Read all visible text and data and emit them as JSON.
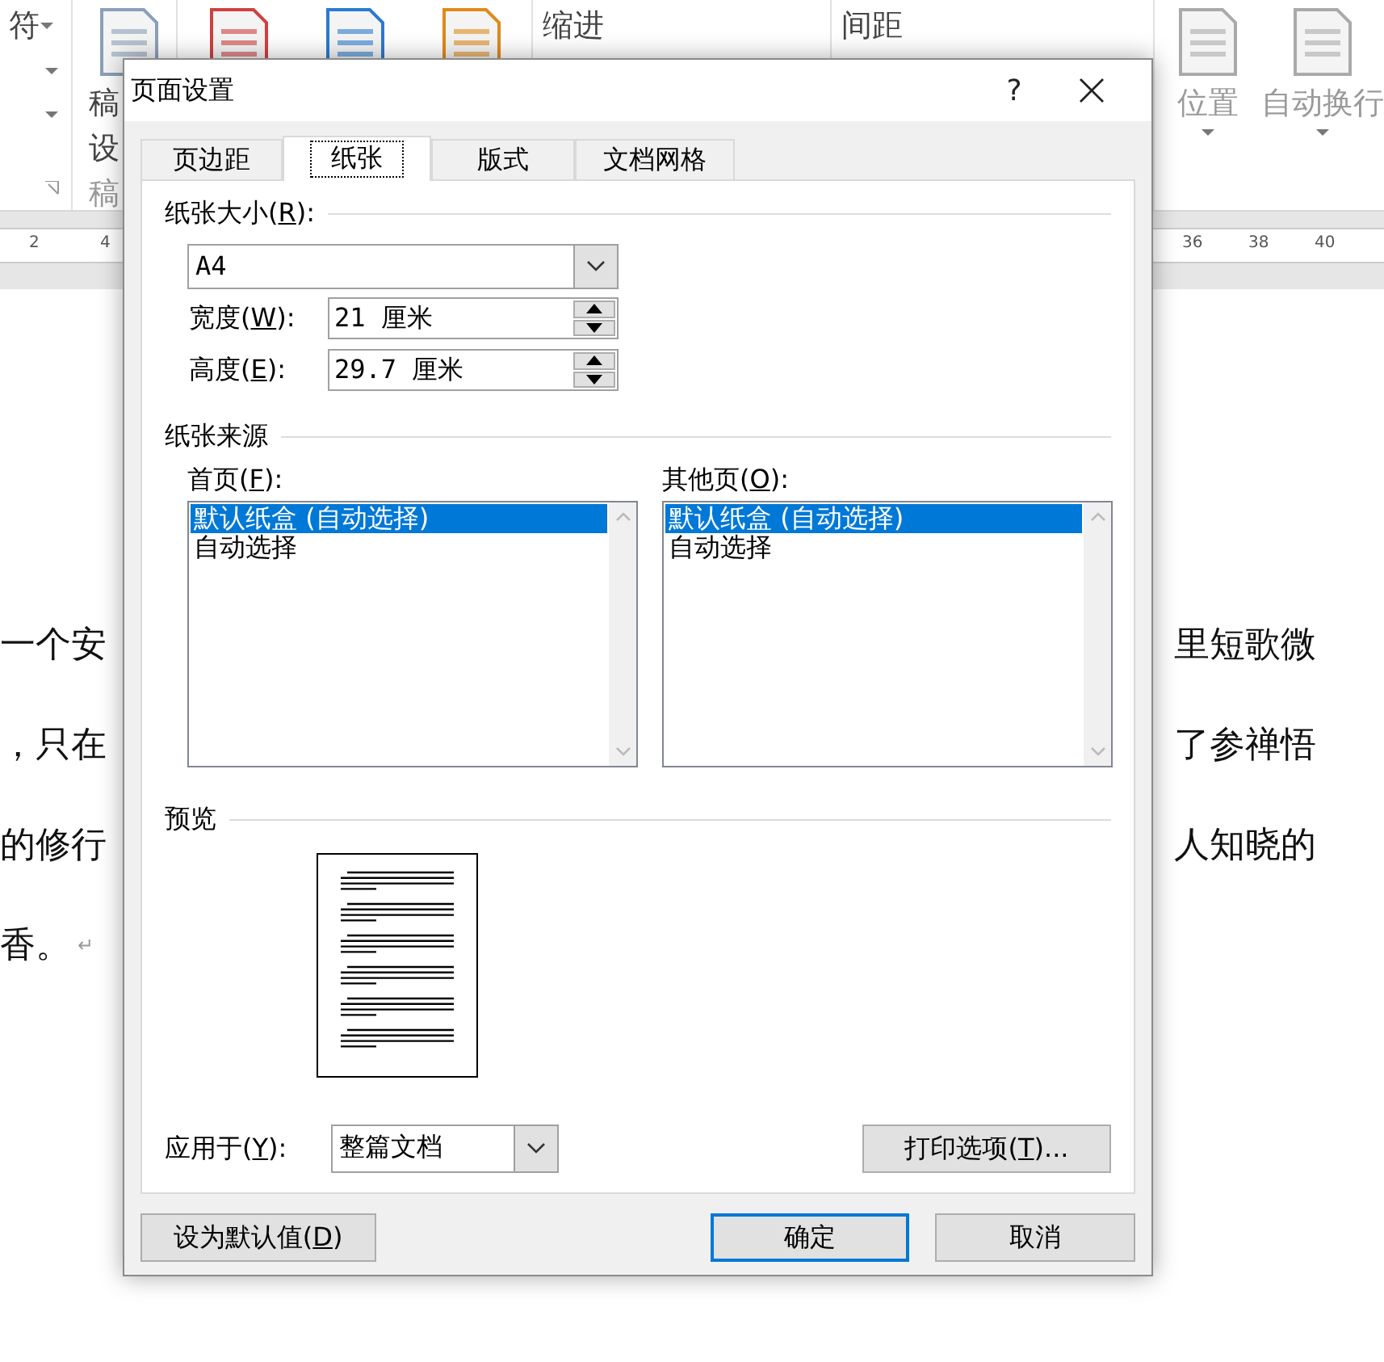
{
  "ribbon": {
    "cut_item": "符",
    "big_button": [
      "稿",
      "设"
    ],
    "group_label": "稿",
    "sections": [
      "缩进",
      "间距"
    ],
    "buttons": [
      "位置",
      "自动换行"
    ]
  },
  "ruler": {
    "left_ticks": [
      "2",
      "4"
    ],
    "right_ticks": [
      "36",
      "38",
      "40"
    ]
  },
  "document": {
    "lines": [
      {
        "left": "一个安",
        "right": "里短歌微"
      },
      {
        "left": "，只在",
        "right": "了参禅悟"
      },
      {
        "left": "的修行",
        "right": "人知晓的"
      },
      {
        "left": "香。",
        "mark": "↵"
      }
    ]
  },
  "dialog": {
    "title": "页面设置",
    "help": "?",
    "tabs": [
      {
        "label": "页边距",
        "selected": false
      },
      {
        "label": "纸张",
        "selected": true
      },
      {
        "label": "版式",
        "selected": false
      },
      {
        "label": "文档网格",
        "selected": false
      }
    ],
    "paper_size": {
      "label": {
        "before": "纸张大小(",
        "key": "R",
        "after": "):"
      },
      "value": "A4"
    },
    "width": {
      "label": {
        "before": "宽度(",
        "key": "W",
        "after": "):"
      },
      "value": "21 厘米"
    },
    "height": {
      "label": {
        "before": "高度(",
        "key": "E",
        "after": "):"
      },
      "value": "29.7 厘米"
    },
    "paper_source": {
      "title": "纸张来源",
      "lists": [
        {
          "label": {
            "before": "首页(",
            "key": "F",
            "after": "):"
          },
          "items": [
            {
              "text": "默认纸盒 (自动选择)",
              "selected": true
            },
            {
              "text": "自动选择",
              "selected": false
            }
          ]
        },
        {
          "label": {
            "before": "其他页(",
            "key": "O",
            "after": "):"
          },
          "items": [
            {
              "text": "默认纸盒 (自动选择)",
              "selected": true
            },
            {
              "text": "自动选择",
              "selected": false
            }
          ]
        }
      ]
    },
    "preview": {
      "title": "预览"
    },
    "apply_to": {
      "label": {
        "before": "应用于(",
        "key": "Y",
        "after": "):"
      },
      "value": "整篇文档"
    },
    "print_options": {
      "before": "打印选项(",
      "key": "T",
      "after": ")..."
    },
    "buttons": [
      {
        "before": "设为默认值(",
        "key": "D",
        "after": ")",
        "focused": false
      },
      {
        "before": "确定",
        "focused": true
      },
      {
        "before": "取消",
        "focused": false
      }
    ]
  }
}
